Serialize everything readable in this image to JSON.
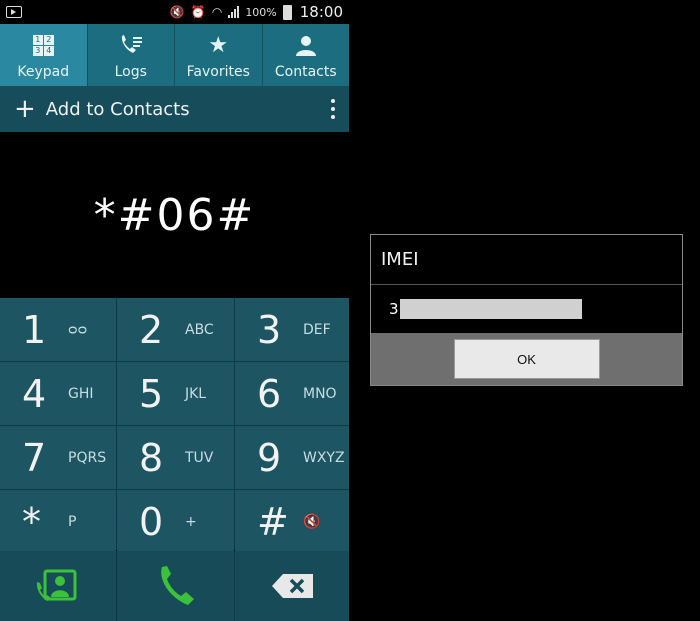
{
  "status_bar": {
    "battery": "100%",
    "time": "18:00"
  },
  "tabs": [
    {
      "label": "Keypad",
      "icon": "keypad-icon",
      "active": true
    },
    {
      "label": "Logs",
      "icon": "call-log-icon",
      "active": false
    },
    {
      "label": "Favorites",
      "icon": "star-icon",
      "active": false
    },
    {
      "label": "Contacts",
      "icon": "person-icon",
      "active": false
    }
  ],
  "keypad_tab_grid": [
    "1",
    "2",
    "3",
    "4"
  ],
  "add_bar": {
    "label": "Add to Contacts"
  },
  "dialed_number": "*#06#",
  "keys": [
    {
      "digit": "1",
      "letters": "ᴑᴑ"
    },
    {
      "digit": "2",
      "letters": "ABC"
    },
    {
      "digit": "3",
      "letters": "DEF"
    },
    {
      "digit": "4",
      "letters": "GHI"
    },
    {
      "digit": "5",
      "letters": "JKL"
    },
    {
      "digit": "6",
      "letters": "MNO"
    },
    {
      "digit": "7",
      "letters": "PQRS"
    },
    {
      "digit": "8",
      "letters": "TUV"
    },
    {
      "digit": "9",
      "letters": "WXYZ"
    },
    {
      "digit": "*",
      "letters": "P"
    },
    {
      "digit": "0",
      "letters": "+"
    },
    {
      "digit": "#",
      "letters": ""
    }
  ],
  "dialog": {
    "title": "IMEI",
    "value_prefix": "3",
    "ok_label": "OK"
  },
  "colors": {
    "tab_bg": "#1c6d7f",
    "tab_active": "#2a89a0",
    "key_bg": "#1d5562",
    "call_green": "#3cc13b"
  }
}
